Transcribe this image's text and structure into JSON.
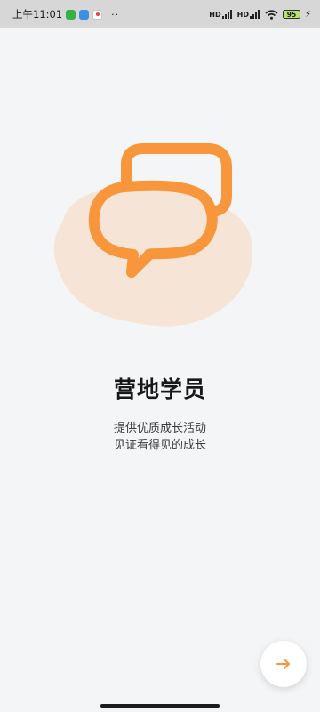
{
  "status_bar": {
    "time": "上午11:01",
    "more": "··",
    "signal1_label": "HD",
    "signal2_label": "HD",
    "battery": "95",
    "app_icons": [
      "green-app-icon",
      "weather-icon",
      "map-icon"
    ]
  },
  "onboarding": {
    "title": "营地学员",
    "subtitle_line1": "提供优质成长活动",
    "subtitle_line2": "见证看得见的成长",
    "illustration": "chat-bubbles-icon",
    "next_icon": "arrow-right-icon"
  },
  "colors": {
    "accent": "#f7963a",
    "blob": "#f6e5d6",
    "background": "#f3f5f7"
  }
}
